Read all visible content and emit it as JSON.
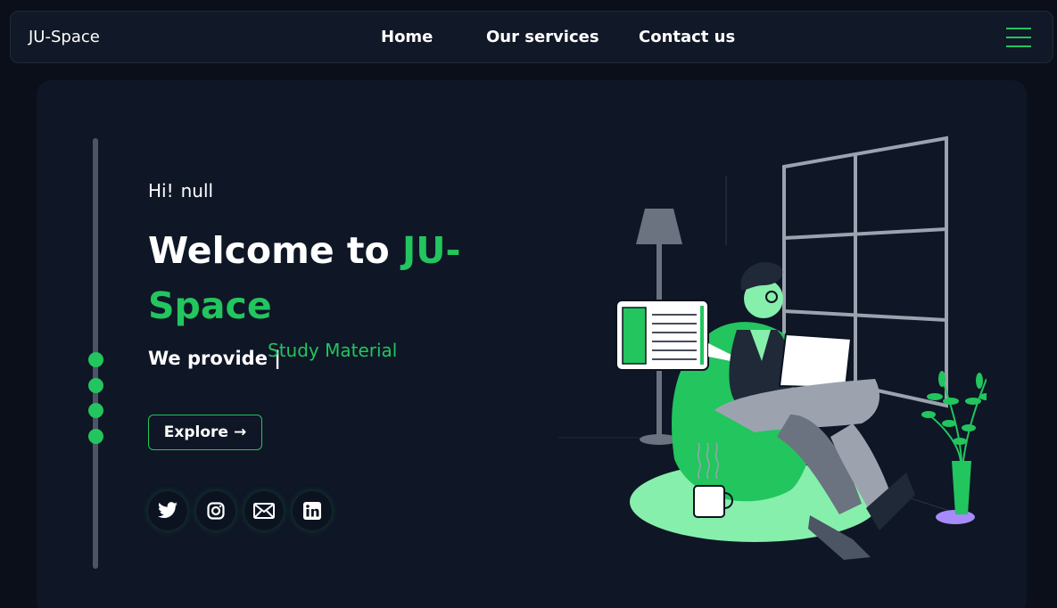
{
  "nav": {
    "brand": "JU-Space",
    "links": [
      {
        "label": "Home"
      },
      {
        "label": "Our services"
      },
      {
        "label": "Contact us"
      }
    ],
    "menu_icon": "hamburger-icon"
  },
  "hero": {
    "greeting": "Hi!",
    "username": "null",
    "title_part1": "Welcome to ",
    "title_accent": "JU-Space",
    "provide_label": "We provide |",
    "typed_text": "Study Material",
    "explore_label": "Explore",
    "explore_icon": "arrow-right-icon",
    "social_icons": [
      "twitter-icon",
      "instagram-icon",
      "mail-icon",
      "linkedin-icon"
    ]
  },
  "colors": {
    "background": "#0a0f1a",
    "panel": "#0f1626",
    "accent": "#22c55e",
    "text": "#ffffff"
  }
}
